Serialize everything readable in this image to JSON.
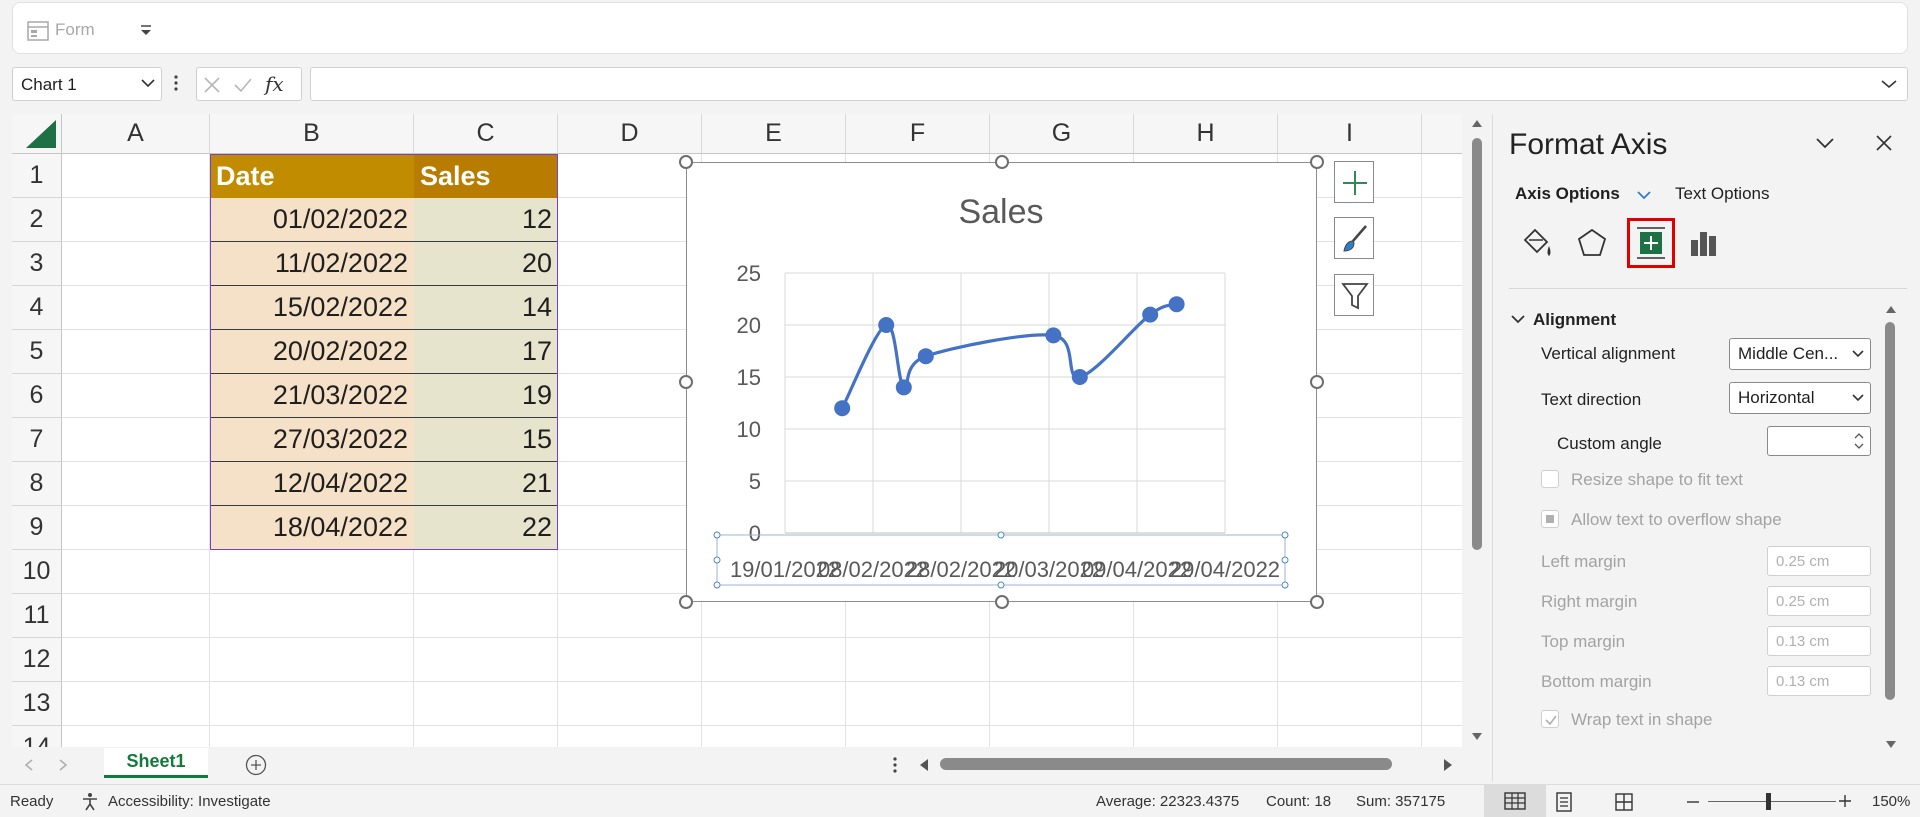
{
  "ribbon": {
    "form_label": "Form"
  },
  "formula_bar": {
    "name_box": "Chart 1",
    "fx_label": "fx",
    "formula": ""
  },
  "grid": {
    "columns": [
      "A",
      "B",
      "C",
      "D",
      "E",
      "F",
      "G",
      "H",
      "I"
    ],
    "rows": [
      "1",
      "2",
      "3",
      "4",
      "5",
      "6",
      "7",
      "8",
      "9",
      "10",
      "11",
      "12",
      "13",
      "14"
    ],
    "table": {
      "headers": [
        "Date",
        "Sales"
      ],
      "rows": [
        [
          "01/02/2022",
          "12"
        ],
        [
          "11/02/2022",
          "20"
        ],
        [
          "15/02/2022",
          "14"
        ],
        [
          "20/02/2022",
          "17"
        ],
        [
          "21/03/2022",
          "19"
        ],
        [
          "27/03/2022",
          "15"
        ],
        [
          "12/04/2022",
          "21"
        ],
        [
          "18/04/2022",
          "22"
        ]
      ]
    }
  },
  "chart_data": {
    "type": "scatter",
    "title": "Sales",
    "smooth_lines": true,
    "x": [
      "01/02/2022",
      "11/02/2022",
      "15/02/2022",
      "20/02/2022",
      "21/03/2022",
      "27/03/2022",
      "12/04/2022",
      "18/04/2022"
    ],
    "y": [
      12,
      20,
      14,
      17,
      19,
      15,
      21,
      22
    ],
    "xlim": [
      "19/01/2022",
      "29/04/2022"
    ],
    "ylim": [
      0,
      25
    ],
    "y_ticks": [
      "0",
      "5",
      "10",
      "15",
      "20",
      "25"
    ],
    "x_tick_labels": [
      "19/01/2022",
      "08/02/2022",
      "28/02/2022",
      "20/03/2022",
      "09/04/2022",
      "29/04/2022"
    ],
    "grid": true,
    "series_color": "#4472c4"
  },
  "tabs": {
    "sheet1": "Sheet1"
  },
  "status": {
    "ready": "Ready",
    "accessibility": "Accessibility: Investigate",
    "average": "Average: 22323.4375",
    "count": "Count: 18",
    "sum": "Sum: 357175",
    "zoom": "150%"
  },
  "pane": {
    "title": "Format Axis",
    "tab_axis_options": "Axis Options",
    "tab_text_options": "Text Options",
    "section": "Alignment",
    "vertical_alignment_label": "Vertical alignment",
    "vertical_alignment_value": "Middle Cen...",
    "text_direction_label": "Text direction",
    "text_direction_value": "Horizontal",
    "custom_angle_label": "Custom angle",
    "resize_label": "Resize shape to fit text",
    "overflow_label": "Allow text to overflow shape",
    "left_margin_label": "Left margin",
    "left_margin_value": "0.25 cm",
    "right_margin_label": "Right margin",
    "right_margin_value": "0.25 cm",
    "top_margin_label": "Top margin",
    "top_margin_value": "0.13 cm",
    "bottom_margin_label": "Bottom margin",
    "bottom_margin_value": "0.13 cm",
    "wrap_label": "Wrap text in shape"
  },
  "colors": {
    "accent": "#137a3d",
    "chart_series": "#4472c4",
    "selected_tab_outline": "#e00000"
  }
}
